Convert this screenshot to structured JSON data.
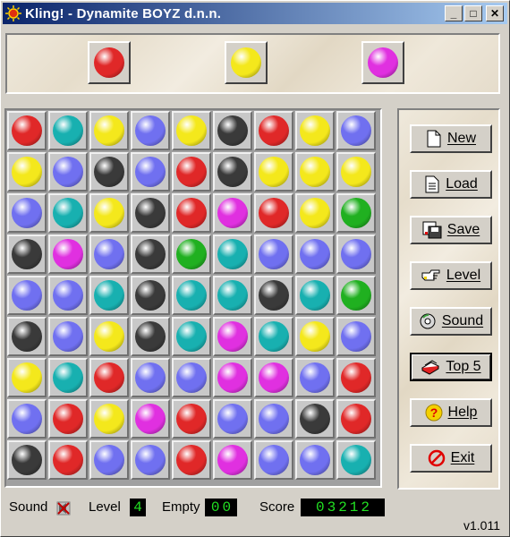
{
  "window": {
    "title": "Kling! - Dynamite BOYZ d.n.n.",
    "minimize": "_",
    "maximize": "□",
    "close": "✕"
  },
  "colors": {
    "red": "#e02828",
    "teal": "#18b0b0",
    "yellow": "#f4e81c",
    "blue": "#7070f0",
    "black": "#3a3a3a",
    "magenta": "#e030e0",
    "green": "#20b020"
  },
  "preview": [
    "red",
    "yellow",
    "magenta"
  ],
  "board": [
    [
      "red",
      "teal",
      "yellow",
      "blue",
      "yellow",
      "black",
      "red",
      "yellow",
      "blue"
    ],
    [
      "yellow",
      "blue",
      "black",
      "blue",
      "red",
      "black",
      "yellow",
      "yellow",
      "yellow"
    ],
    [
      "blue",
      "teal",
      "yellow",
      "black",
      "red",
      "magenta",
      "red",
      "yellow",
      "green"
    ],
    [
      "black",
      "magenta",
      "blue",
      "black",
      "green",
      "teal",
      "blue",
      "blue",
      "blue"
    ],
    [
      "blue",
      "blue",
      "teal",
      "black",
      "teal",
      "teal",
      "black",
      "teal",
      "green"
    ],
    [
      "black",
      "blue",
      "yellow",
      "black",
      "teal",
      "magenta",
      "teal",
      "yellow",
      "blue"
    ],
    [
      "yellow",
      "teal",
      "red",
      "blue",
      "blue",
      "magenta",
      "magenta",
      "blue",
      "red"
    ],
    [
      "blue",
      "red",
      "yellow",
      "magenta",
      "red",
      "blue",
      "blue",
      "black",
      "red"
    ],
    [
      "black",
      "red",
      "blue",
      "blue",
      "red",
      "magenta",
      "blue",
      "blue",
      "teal"
    ]
  ],
  "buttons": [
    {
      "id": "new",
      "label": "New",
      "icon": "new-document-icon"
    },
    {
      "id": "load",
      "label": "Load",
      "icon": "load-document-icon"
    },
    {
      "id": "save",
      "label": "Save",
      "icon": "save-disk-icon"
    },
    {
      "id": "level",
      "label": "Level",
      "icon": "level-hand-icon"
    },
    {
      "id": "sound",
      "label": "Sound",
      "icon": "sound-cd-icon"
    },
    {
      "id": "top5",
      "label": "Top 5",
      "icon": "top5-books-icon"
    },
    {
      "id": "help",
      "label": "Help",
      "icon": "help-question-icon"
    },
    {
      "id": "exit",
      "label": "Exit",
      "icon": "exit-no-icon"
    }
  ],
  "status": {
    "sound_label": "Sound",
    "level_label": "Level",
    "level_value": "4",
    "empty_label": "Empty",
    "empty_value": "00",
    "score_label": "Score",
    "score_value": "03212"
  },
  "version": "v1.011"
}
